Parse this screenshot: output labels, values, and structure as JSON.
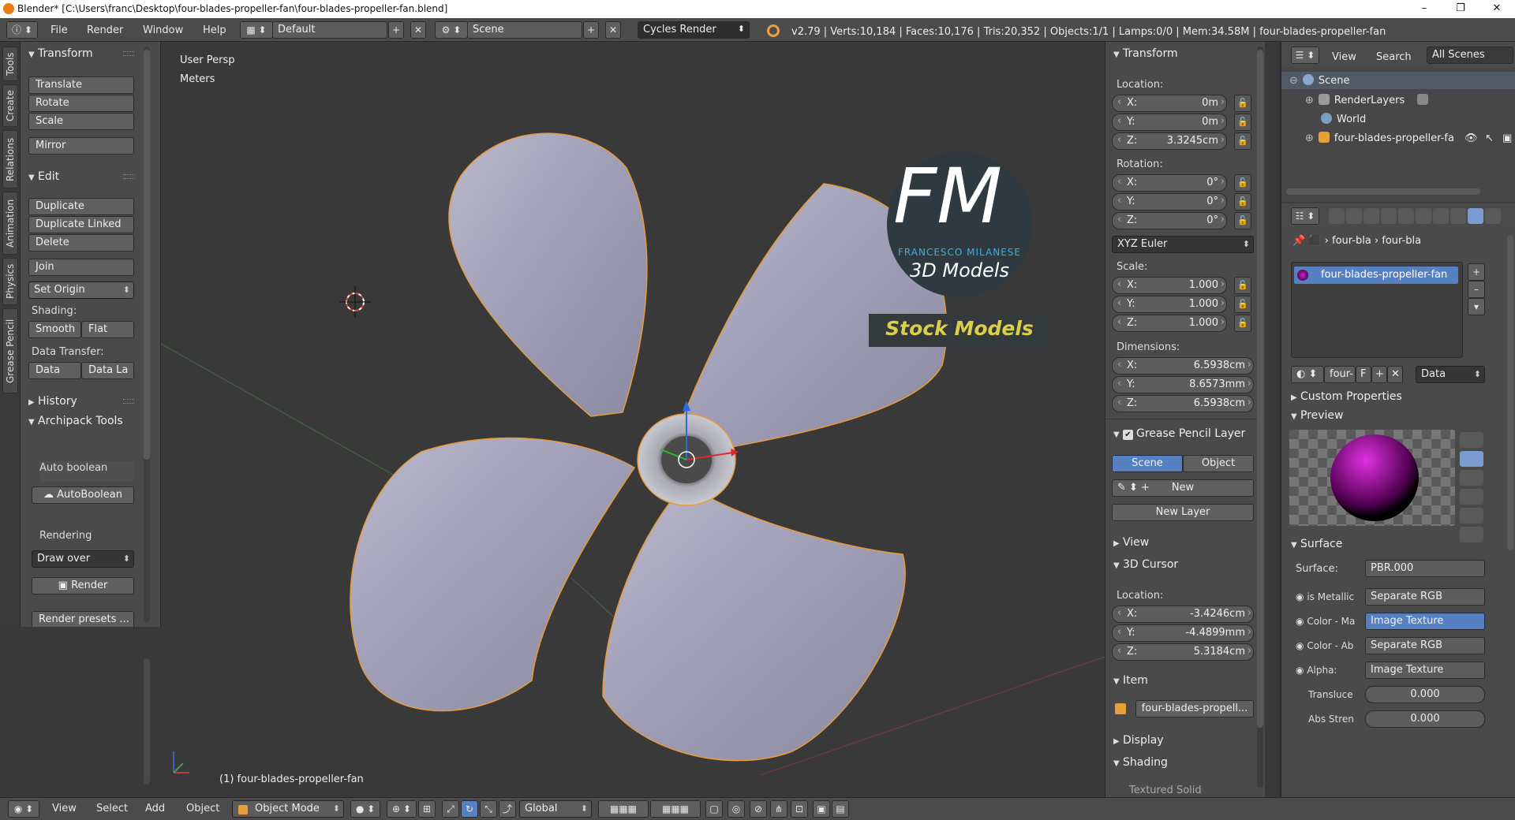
{
  "window": {
    "title": "Blender* [C:\\Users\\franc\\Desktop\\four-blades-propeller-fan\\four-blades-propeller-fan.blend]",
    "minimize": "–",
    "maximize": "❐",
    "close": "✕"
  },
  "menubar": {
    "items": [
      "File",
      "Render",
      "Window",
      "Help"
    ],
    "layout": "Default",
    "scene": "Scene",
    "engine": "Cycles Render",
    "info": "v2.79 | Verts:10,184 | Faces:10,176 | Tris:20,352 | Objects:1/1 | Lamps:0/0 | Mem:34.58M | four-blades-propeller-fan"
  },
  "tool_tabs": [
    "Tools",
    "Create",
    "Relations",
    "Animation",
    "Physics",
    "Grease Pencil"
  ],
  "tools": {
    "transform_header": "Transform",
    "translate": "Translate",
    "rotate": "Rotate",
    "scale": "Scale",
    "mirror": "Mirror",
    "edit_header": "Edit",
    "duplicate": "Duplicate",
    "duplicate_linked": "Duplicate Linked",
    "delete": "Delete",
    "join": "Join",
    "set_origin": "Set Origin",
    "shading_label": "Shading:",
    "smooth": "Smooth",
    "flat": "Flat",
    "data_transfer_label": "Data Transfer:",
    "data": "Data",
    "data_layout": "Data La",
    "history_header": "History",
    "archipack_header": "Archipack Tools",
    "auto_boolean_label": "Auto boolean",
    "auto_boolean_btn": "AutoBoolean",
    "rendering_label": "Rendering",
    "draw_over": "Draw over",
    "render_btn": "Render",
    "render_presets": "Render presets ..."
  },
  "viewport": {
    "view_name": "User Persp",
    "units": "Meters",
    "object_label": "(1) four-blades-propeller-fan",
    "watermark": {
      "letters": "FM",
      "brand": "FRANCESCO MILANESE",
      "line": "3D Models",
      "banner": "Stock Models"
    }
  },
  "npanel": {
    "transform_header": "Transform",
    "location_label": "Location:",
    "location": [
      {
        "k": "X:",
        "v": "0m"
      },
      {
        "k": "Y:",
        "v": "0m"
      },
      {
        "k": "Z:",
        "v": "3.3245cm"
      }
    ],
    "rotation_label": "Rotation:",
    "rotation": [
      {
        "k": "X:",
        "v": "0°"
      },
      {
        "k": "Y:",
        "v": "0°"
      },
      {
        "k": "Z:",
        "v": "0°"
      }
    ],
    "rotation_mode": "XYZ Euler",
    "scale_label": "Scale:",
    "scale": [
      {
        "k": "X:",
        "v": "1.000"
      },
      {
        "k": "Y:",
        "v": "1.000"
      },
      {
        "k": "Z:",
        "v": "1.000"
      }
    ],
    "dimensions_label": "Dimensions:",
    "dimensions": [
      {
        "k": "X:",
        "v": "6.5938cm"
      },
      {
        "k": "Y:",
        "v": "8.6573mm"
      },
      {
        "k": "Z:",
        "v": "6.5938cm"
      }
    ],
    "gp_header": "Grease Pencil Layer",
    "gp_scene": "Scene",
    "gp_object": "Object",
    "gp_new": "New",
    "gp_new_layer": "New Layer",
    "view_header": "View",
    "cursor_header": "3D Cursor",
    "cursor_location_label": "Location:",
    "cursor": [
      {
        "k": "X:",
        "v": "-3.4246cm"
      },
      {
        "k": "Y:",
        "v": "-4.4899mm"
      },
      {
        "k": "Z:",
        "v": "5.3184cm"
      }
    ],
    "item_header": "Item",
    "item_name": "four-blades-propell...",
    "display_header": "Display",
    "shading_header": "Shading",
    "textured_solid": "Textured Solid"
  },
  "outliner": {
    "view": "View",
    "search": "Search",
    "filter": "All Scenes",
    "items": [
      "Scene",
      "RenderLayers",
      "World",
      "four-blades-propeller-fa"
    ]
  },
  "properties": {
    "breadcrumb_obj": "four-bla",
    "breadcrumb_mat": "four-bla",
    "material_slot": "four-blades-propeller-fan",
    "mat_name": "four-b",
    "fake": "F",
    "link": "Data",
    "custom_props": "Custom Properties",
    "preview": "Preview",
    "surface_header": "Surface",
    "surface_label": "Surface:",
    "surface_value": "PBR.000",
    "rows": [
      {
        "k": "is Metallic",
        "v": "Separate RGB"
      },
      {
        "k": "Color - Ma",
        "v": "Image Texture"
      },
      {
        "k": "Color - Ab",
        "v": "Separate RGB"
      },
      {
        "k": "Alpha:",
        "v": "Image Texture"
      }
    ],
    "translucency_label": "Transluce",
    "translucency": "0.000",
    "abs_label": "Abs Stren",
    "abs": "0.000"
  },
  "bottombar": {
    "items": [
      "View",
      "Select",
      "Add",
      "Object"
    ],
    "mode": "Object Mode",
    "orientation": "Global"
  }
}
